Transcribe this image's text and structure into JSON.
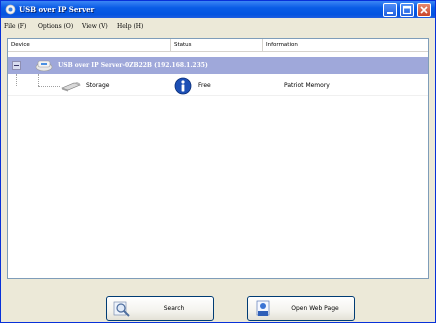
{
  "window": {
    "title": "USB over IP Server",
    "icon": "usb-server-app-icon",
    "title_color": "#0054e3"
  },
  "menu": {
    "items": [
      {
        "label": "File (F)"
      },
      {
        "label": "Options (O)"
      },
      {
        "label": "View (V)"
      },
      {
        "label": "Help (H)"
      }
    ]
  },
  "list": {
    "columns": [
      {
        "label": "Device"
      },
      {
        "label": "Status"
      },
      {
        "label": "Information"
      }
    ],
    "server": {
      "label": "USB over IP Server-0ZB22B (192.168.1.235)",
      "expanded": true,
      "highlight_color": "#9fa8da"
    },
    "devices": [
      {
        "name": "Storage",
        "status": "Free",
        "information": "Patriot Memory",
        "icon": "usb-storage-icon",
        "status_icon": "info-icon"
      }
    ]
  },
  "buttons": {
    "search_label": "Search",
    "open_web_label": "Open Web Page"
  }
}
